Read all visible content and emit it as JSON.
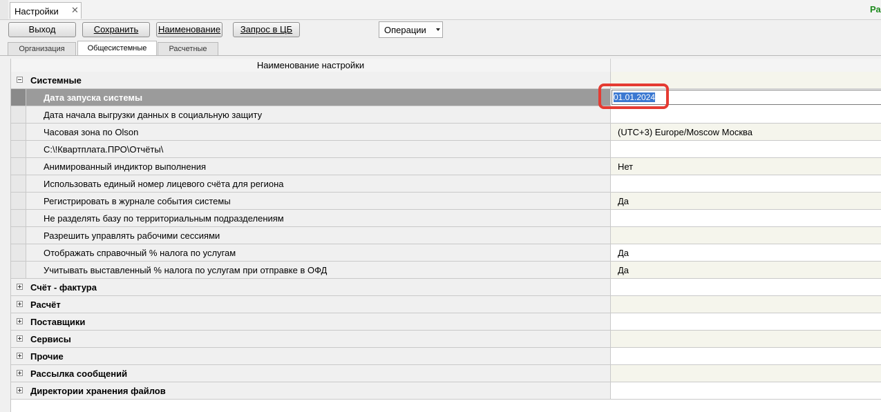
{
  "window": {
    "tab_title": "Настройки",
    "tab_close": "✕",
    "corner_text": "Ра"
  },
  "toolbar": {
    "exit_label": "Выход",
    "save_label": "Сохранить",
    "name_label": "Наименование",
    "cb_request_label": "Запрос в ЦБ",
    "operations_label": "Операции"
  },
  "tabs": [
    {
      "label": "Организация"
    },
    {
      "label": "Общесистемные"
    },
    {
      "label": "Расчетные"
    }
  ],
  "active_tab": "Общесистемные",
  "grid": {
    "header_name": "Наименование настройки",
    "header_value": "",
    "groups": [
      {
        "label": "Системные",
        "expanded": true,
        "items": [
          {
            "name": "Дата запуска системы",
            "value": "01.01.2024",
            "selected": true
          },
          {
            "name": "Дата начала выгрузки данных в социальную защиту",
            "value": ""
          },
          {
            "name": "Часовая зона по Olson",
            "value": "(UTC+3) Europe/Moscow Москва"
          },
          {
            "name": "C:\\!Квартплата.ПРО\\Отчёты\\",
            "value": ""
          },
          {
            "name": "Анимированный индиктор выполнения",
            "value": "Нет"
          },
          {
            "name": "Использовать единый номер лицевого счёта для региона",
            "value": ""
          },
          {
            "name": "Регистрировать в журнале события системы",
            "value": "Да"
          },
          {
            "name": "Не разделять базу по территориальным подразделениям",
            "value": ""
          },
          {
            "name": "Разрешить управлять рабочими сессиями",
            "value": ""
          },
          {
            "name": "Отображать справочный % налога по услугам",
            "value": "Да"
          },
          {
            "name": "Учитывать выставленный % налога по услугам при отправке в ОФД",
            "value": "Да"
          }
        ]
      },
      {
        "label": "Счёт - фактура",
        "expanded": false
      },
      {
        "label": "Расчёт",
        "expanded": false
      },
      {
        "label": "Поставщики",
        "expanded": false
      },
      {
        "label": "Сервисы",
        "expanded": false
      },
      {
        "label": "Прочие",
        "expanded": false
      },
      {
        "label": "Рассылка сообщений",
        "expanded": false
      },
      {
        "label": "Директории хранения файлов",
        "expanded": false
      }
    ]
  },
  "icons": {
    "collapse": "minus-box-icon",
    "expand": "plus-box-icon",
    "dropdown": "caret-down-icon"
  },
  "colors": {
    "highlight": "#e53b32",
    "selected_row": "#9b9b9b",
    "selection": "#3b78d1",
    "corner_text": "#1d8a1d"
  }
}
